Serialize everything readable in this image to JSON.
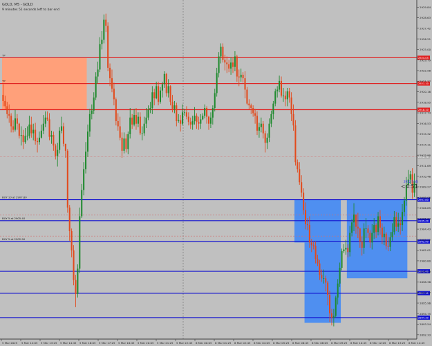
{
  "window": {
    "symbol_line": "GOLD, M5 - GOLD",
    "info_line": "9 minutes 51 seconds left to bar end",
    "countdown": "<4:51",
    "current_price_label": "2912.7 (4)"
  },
  "colors": {
    "background": "#c0c0c0",
    "bull": "#1f8a2e",
    "bear": "#e24a1c",
    "tp_zone": "#ffa07a",
    "buy_zone": "#4f8ff0",
    "resistance_line": "#e02020",
    "support_line": "#1010d0",
    "grid": "#808080"
  },
  "price_axis": {
    "min": 2892.0,
    "max": 2930.5,
    "ticks": [
      "2929.84",
      "2928.63",
      "2927.42",
      "2926.21",
      "2925.00",
      "2923.79",
      "2922.58",
      "2921.37",
      "2920.16",
      "2918.95",
      "2917.74",
      "2916.53",
      "2915.32",
      "2914.11",
      "2912.90",
      "2911.69",
      "2910.48",
      "2909.27",
      "2908.06",
      "2906.85",
      "2905.64",
      "2904.43",
      "2903.22",
      "2902.01",
      "2900.80",
      "2899.59",
      "2898.38",
      "2897.17",
      "2895.96",
      "2894.75",
      "2893.54",
      "2892.33"
    ]
  },
  "time_axis": {
    "labels": [
      "5 Mar 2025",
      "5 Mar 12:05",
      "5 Mar 13:25",
      "5 Mar 14:45",
      "5 Mar 16:05",
      "5 Mar 17:25",
      "5 Mar 18:45",
      "5 Mar 20:05",
      "5 Mar 21:25",
      "5 Mar 22:45",
      "6 Mar 00:05",
      "6 Mar 01:25",
      "6 Mar 02:45",
      "6 Mar 04:05",
      "6 Mar 05:25",
      "6 Mar 06:45",
      "6 Mar 08:05",
      "6 Mar 09:25",
      "6 Mar 10:45",
      "6 Mar 12:05",
      "6 Mar 13:25",
      "6 Mar 14:45"
    ]
  },
  "levels": [
    {
      "price": 2924.05,
      "kind": "resistance",
      "tag": "TP",
      "axis_label": "2924.05"
    },
    {
      "price": 2921.1,
      "kind": "resistance",
      "tag": "TP",
      "axis_label": "2921.10"
    },
    {
      "price": 2918.1,
      "kind": "resistance",
      "tag": "",
      "axis_label": "2918.10"
    },
    {
      "price": 2912.7,
      "kind": "current",
      "tag": "",
      "axis_label": "2912.70"
    },
    {
      "price": 2907.8,
      "kind": "support",
      "tag": "BUY 10 at 2907.80",
      "axis_label": "2907.80"
    },
    {
      "price": 2905.4,
      "kind": "support",
      "tag": "BUY 5 at 2905.40",
      "axis_label": "2905.40"
    },
    {
      "price": 2903.0,
      "kind": "support",
      "tag": "BUY 5 at 2902.90",
      "axis_label": "2902.90"
    },
    {
      "price": 2899.6,
      "kind": "support",
      "tag": "",
      "axis_label": "2899.60"
    },
    {
      "price": 2897.1,
      "kind": "support",
      "tag": "",
      "axis_label": "2897.10"
    },
    {
      "price": 2894.3,
      "kind": "support",
      "tag": "",
      "axis_label": "2894.30"
    }
  ],
  "zones": [
    {
      "kind": "tp",
      "from_price": 2918.1,
      "to_price": 2924.05,
      "bars": [
        0,
        42
      ]
    },
    {
      "kind": "buy",
      "from_price": 2902.9,
      "to_price": 2907.8,
      "bars": [
        145,
        168
      ]
    },
    {
      "kind": "buy",
      "from_price": 2893.7,
      "to_price": 2902.9,
      "bars": [
        150,
        168
      ]
    },
    {
      "kind": "buy",
      "from_price": 2898.8,
      "to_price": 2907.8,
      "bars": [
        171,
        201
      ]
    }
  ],
  "chart_data": {
    "type": "candlestick",
    "close": [
      2919.1,
      2918.5,
      2917.6,
      2917.4,
      2916.2,
      2915.8,
      2917.1,
      2916.5,
      2915.1,
      2915.2,
      2914.4,
      2915.1,
      2915.1,
      2916.4,
      2915.4,
      2915.8,
      2914.5,
      2914.4,
      2914.9,
      2915.7,
      2916.5,
      2917.2,
      2917.0,
      2915.0,
      2915.2,
      2914.0,
      2912.8,
      2913.5,
      2915.7,
      2916.2,
      2914.2,
      2913.4,
      2906.9,
      2904.2,
      2902.0,
      2898.6,
      2897.0,
      2899.9,
      2905.9,
      2908.9,
      2911.3,
      2913.3,
      2915.6,
      2917.6,
      2918.0,
      2919.5,
      2921.9,
      2922.7,
      2925.6,
      2926.1,
      2928.4,
      2927.7,
      2922.9,
      2921.7,
      2920.5,
      2919.3,
      2916.8,
      2916.2,
      2914.9,
      2913.4,
      2914.8,
      2913.6,
      2915.3,
      2917.2,
      2916.4,
      2917.5,
      2916.5,
      2917.3,
      2915.4,
      2915.4,
      2916.5,
      2917.2,
      2918.1,
      2918.3,
      2920.1,
      2919.4,
      2920.8,
      2919.0,
      2920.3,
      2921.0,
      2922.2,
      2920.0,
      2920.8,
      2919.0,
      2918.2,
      2918.6,
      2916.8,
      2916.9,
      2916.5,
      2917.8,
      2917.8,
      2917.3,
      2916.7,
      2916.4,
      2916.8,
      2917.4,
      2916.7,
      2916.5,
      2917.0,
      2917.4,
      2918.3,
      2917.3,
      2916.5,
      2917.2,
      2918.3,
      2920.0,
      2922.3,
      2924.2,
      2925.3,
      2923.8,
      2923.5,
      2923.3,
      2922.8,
      2923.5,
      2923.0,
      2924.2,
      2921.9,
      2921.8,
      2922.1,
      2921.7,
      2920.4,
      2918.8,
      2918.6,
      2918.3,
      2917.7,
      2917.4,
      2915.7,
      2916.1,
      2916.5,
      2915.4,
      2914.3,
      2914.9,
      2916.5,
      2917.6,
      2918.8,
      2920.2,
      2920.4,
      2921.4,
      2919.7,
      2919.7,
      2919.3,
      2920.2,
      2919.5,
      2917.6,
      2916.3,
      2912.1,
      2911.3,
      2909.8,
      2908.6,
      2906.6,
      2905.0,
      2904.9,
      2902.9,
      2902.6,
      2902.5,
      2901.0,
      2900.5,
      2899.2,
      2898.8,
      2898.8,
      2898.3,
      2896.9,
      2894.8,
      2894.3,
      2894.5,
      2896.6,
      2898.2,
      2900.0,
      2901.9,
      2902.1,
      2902.3,
      2901.8,
      2904.0,
      2905.2,
      2906.1,
      2904.7,
      2904.5,
      2903.0,
      2902.3,
      2904.5,
      2904.5,
      2904.0,
      2902.9,
      2904.0,
      2904.9,
      2904.1,
      2905.9,
      2904.6,
      2903.5,
      2903.9,
      2902.5,
      2902.4,
      2903.5,
      2904.1,
      2905.8,
      2904.7,
      2905.1,
      2904.9,
      2906.4,
      2907.7,
      2909.5,
      2910.1,
      2910.7,
      2908.6,
      2909.9
    ],
    "high": [
      2921.0,
      2919.7,
      2919.0,
      2918.7,
      2917.7,
      2916.9,
      2918.1,
      2917.6,
      2916.6,
      2916.2,
      2915.8,
      2916.0,
      2916.2,
      2917.4,
      2917.3,
      2916.5,
      2916.6,
      2914.9,
      2915.6,
      2916.4,
      2917.5,
      2917.9,
      2917.9,
      2917.7,
      2915.7,
      2915.6,
      2914.2,
      2914.3,
      2916.1,
      2917.3,
      2916.6,
      2914.1,
      2913.6,
      2907.2,
      2904.5,
      2902.6,
      2899.2,
      2900.4,
      2906.9,
      2909.6,
      2912.1,
      2914.4,
      2916.4,
      2918.2,
      2918.7,
      2920.1,
      2922.4,
      2923.6,
      2926.4,
      2927.1,
      2929.0,
      2929.1,
      2928.1,
      2923.4,
      2922.7,
      2921.2,
      2919.5,
      2917.7,
      2917.3,
      2915.5,
      2915.5,
      2915.3,
      2915.6,
      2918.3,
      2917.6,
      2918.2,
      2918.3,
      2917.8,
      2917.8,
      2916.2,
      2917.3,
      2918.3,
      2918.6,
      2919.0,
      2920.8,
      2920.5,
      2921.3,
      2921.3,
      2920.7,
      2921.3,
      2922.5,
      2922.3,
      2921.6,
      2920.9,
      2919.8,
      2919.1,
      2918.9,
      2917.6,
      2917.5,
      2918.7,
      2918.2,
      2918.5,
      2917.8,
      2917.2,
      2917.4,
      2918.4,
      2917.7,
      2917.3,
      2917.6,
      2917.7,
      2918.7,
      2918.5,
      2917.4,
      2917.8,
      2918.6,
      2920.5,
      2922.9,
      2924.7,
      2925.7,
      2925.7,
      2924.4,
      2924.2,
      2923.8,
      2924.1,
      2924.1,
      2924.8,
      2924.4,
      2922.7,
      2922.8,
      2922.4,
      2922.5,
      2920.7,
      2919.3,
      2918.8,
      2918.6,
      2918.2,
      2917.9,
      2916.6,
      2917.2,
      2916.8,
      2915.7,
      2915.4,
      2917.1,
      2918.0,
      2919.1,
      2920.5,
      2920.8,
      2922.0,
      2921.9,
      2920.6,
      2920.2,
      2920.6,
      2920.6,
      2920.1,
      2918.7,
      2916.9,
      2912.4,
      2912.1,
      2910.6,
      2909.1,
      2907.5,
      2905.7,
      2905.9,
      2903.3,
      2903.0,
      2903.0,
      2901.5,
      2900.9,
      2899.8,
      2899.8,
      2899.1,
      2898.5,
      2897.4,
      2895.3,
      2895.3,
      2896.8,
      2898.7,
      2900.6,
      2902.2,
      2902.7,
      2903.2,
      2902.7,
      2904.8,
      2905.6,
      2907.4,
      2906.1,
      2906.3,
      2904.6,
      2903.6,
      2905.1,
      2905.7,
      2904.9,
      2904.3,
      2905.0,
      2905.7,
      2905.1,
      2906.4,
      2906.6,
      2905.1,
      2904.7,
      2904.1,
      2903.5,
      2904.1,
      2905.1,
      2906.5,
      2906.4,
      2906.3,
      2905.8,
      2907.3,
      2908.1,
      2910.4,
      2911.2,
      2911.1,
      2911.4,
      2910.8
    ],
    "low": [
      2918.5,
      2918.2,
      2917.1,
      2916.6,
      2915.5,
      2915.5,
      2915.6,
      2915.8,
      2914.8,
      2914.0,
      2913.6,
      2914.2,
      2914.6,
      2914.8,
      2914.9,
      2914.6,
      2914.1,
      2913.2,
      2914.1,
      2914.8,
      2915.3,
      2916.1,
      2916.8,
      2914.6,
      2914.2,
      2913.4,
      2912.4,
      2911.6,
      2913.1,
      2915.4,
      2913.9,
      2912.6,
      2906.3,
      2903.1,
      2901.2,
      2898.0,
      2895.5,
      2896.6,
      2899.4,
      2905.7,
      2908.3,
      2910.8,
      2912.7,
      2915.0,
      2917.0,
      2917.6,
      2919.2,
      2921.1,
      2922.4,
      2925.0,
      2925.7,
      2927.0,
      2922.5,
      2920.8,
      2920.1,
      2918.6,
      2916.3,
      2915.7,
      2914.6,
      2912.6,
      2913.1,
      2913.2,
      2913.0,
      2914.8,
      2915.9,
      2916.2,
      2915.8,
      2916.1,
      2915.2,
      2914.6,
      2915.1,
      2916.0,
      2916.9,
      2917.7,
      2917.6,
      2918.6,
      2919.3,
      2918.6,
      2918.8,
      2919.5,
      2920.6,
      2919.6,
      2919.5,
      2918.6,
      2917.8,
      2917.7,
      2916.2,
      2916.6,
      2915.6,
      2916.3,
      2917.4,
      2917.0,
      2916.3,
      2915.9,
      2915.8,
      2916.4,
      2915.9,
      2915.8,
      2915.9,
      2916.9,
      2917.1,
      2916.5,
      2915.8,
      2916.0,
      2916.4,
      2917.9,
      2919.6,
      2921.8,
      2923.4,
      2923.5,
      2922.6,
      2922.3,
      2922.4,
      2922.1,
      2922.3,
      2922.5,
      2921.3,
      2920.8,
      2921.3,
      2921.2,
      2919.4,
      2918.6,
      2918.1,
      2917.6,
      2917.3,
      2916.5,
      2915.2,
      2914.9,
      2915.5,
      2914.8,
      2913.2,
      2913.6,
      2914.4,
      2916.1,
      2917.0,
      2918.5,
      2919.5,
      2920.1,
      2919.5,
      2919.0,
      2918.5,
      2918.5,
      2918.9,
      2916.8,
      2915.7,
      2911.7,
      2910.9,
      2909.5,
      2908.1,
      2906.1,
      2904.4,
      2904.3,
      2902.3,
      2901.8,
      2902.1,
      2900.5,
      2900.2,
      2898.6,
      2898.4,
      2898.2,
      2897.3,
      2895.7,
      2893.8,
      2893.4,
      2893.3,
      2894.3,
      2895.8,
      2897.8,
      2899.7,
      2901.7,
      2901.5,
      2901.2,
      2901.3,
      2903.6,
      2904.2,
      2903.9,
      2903.4,
      2902.3,
      2901.4,
      2901.6,
      2903.4,
      2903.4,
      2902.3,
      2902.1,
      2903.3,
      2903.4,
      2903.7,
      2903.8,
      2902.7,
      2902.6,
      2902.1,
      2901.9,
      2901.9,
      2903.1,
      2903.8,
      2904.2,
      2904.1,
      2903.8,
      2904.2,
      2905.9,
      2907.1,
      2909.4,
      2909.6,
      2907.9,
      2908.1
    ],
    "open": [
      2919.8,
      2919.1,
      2918.5,
      2917.6,
      2917.4,
      2916.2,
      2915.8,
      2917.1,
      2916.5,
      2915.1,
      2915.2,
      2914.4,
      2915.1,
      2915.1,
      2916.4,
      2915.4,
      2915.8,
      2914.5,
      2914.4,
      2914.9,
      2915.7,
      2916.5,
      2917.2,
      2917.0,
      2915.0,
      2915.2,
      2914.0,
      2912.8,
      2913.5,
      2915.7,
      2916.2,
      2914.2,
      2913.4,
      2906.9,
      2904.2,
      2902.0,
      2898.6,
      2897.0,
      2899.9,
      2905.9,
      2908.9,
      2911.3,
      2913.3,
      2915.6,
      2917.6,
      2918.0,
      2919.5,
      2921.9,
      2922.7,
      2925.6,
      2926.1,
      2928.4,
      2927.7,
      2922.9,
      2921.7,
      2920.5,
      2919.3,
      2916.8,
      2916.2,
      2914.9,
      2913.4,
      2914.8,
      2913.6,
      2915.3,
      2917.2,
      2916.4,
      2917.5,
      2916.5,
      2917.3,
      2915.4,
      2915.4,
      2916.5,
      2917.2,
      2918.1,
      2918.3,
      2920.1,
      2919.4,
      2920.8,
      2919.0,
      2920.3,
      2921.0,
      2922.2,
      2920.0,
      2920.8,
      2919.0,
      2918.2,
      2918.6,
      2916.8,
      2916.9,
      2916.5,
      2917.8,
      2917.8,
      2917.3,
      2916.7,
      2916.4,
      2916.8,
      2917.4,
      2916.7,
      2916.5,
      2917.0,
      2917.4,
      2918.3,
      2917.3,
      2916.5,
      2917.2,
      2918.3,
      2920.0,
      2922.3,
      2924.2,
      2925.3,
      2923.8,
      2923.5,
      2923.3,
      2922.8,
      2923.5,
      2923.0,
      2924.2,
      2921.9,
      2921.8,
      2922.1,
      2921.7,
      2920.4,
      2918.8,
      2918.6,
      2918.3,
      2917.7,
      2917.4,
      2915.7,
      2916.1,
      2916.5,
      2915.4,
      2914.3,
      2914.9,
      2916.5,
      2917.6,
      2918.8,
      2920.2,
      2920.4,
      2921.4,
      2919.7,
      2919.7,
      2919.3,
      2920.2,
      2919.5,
      2917.6,
      2916.3,
      2912.1,
      2911.3,
      2909.8,
      2908.6,
      2906.6,
      2905.0,
      2904.9,
      2902.9,
      2902.6,
      2902.5,
      2901.0,
      2900.5,
      2899.2,
      2898.8,
      2898.8,
      2898.3,
      2896.9,
      2894.8,
      2894.3,
      2894.5,
      2896.6,
      2898.2,
      2900.0,
      2901.9,
      2902.1,
      2902.3,
      2901.8,
      2904.0,
      2905.2,
      2906.1,
      2904.7,
      2904.5,
      2903.0,
      2902.3,
      2904.5,
      2904.5,
      2904.0,
      2902.9,
      2904.0,
      2904.9,
      2904.1,
      2905.9,
      2904.6,
      2903.5,
      2903.9,
      2902.5,
      2902.4,
      2903.5,
      2904.1,
      2905.8,
      2904.7,
      2905.1,
      2904.9,
      2906.4,
      2907.7,
      2909.5,
      2910.1,
      2910.7,
      2908.6
    ]
  }
}
